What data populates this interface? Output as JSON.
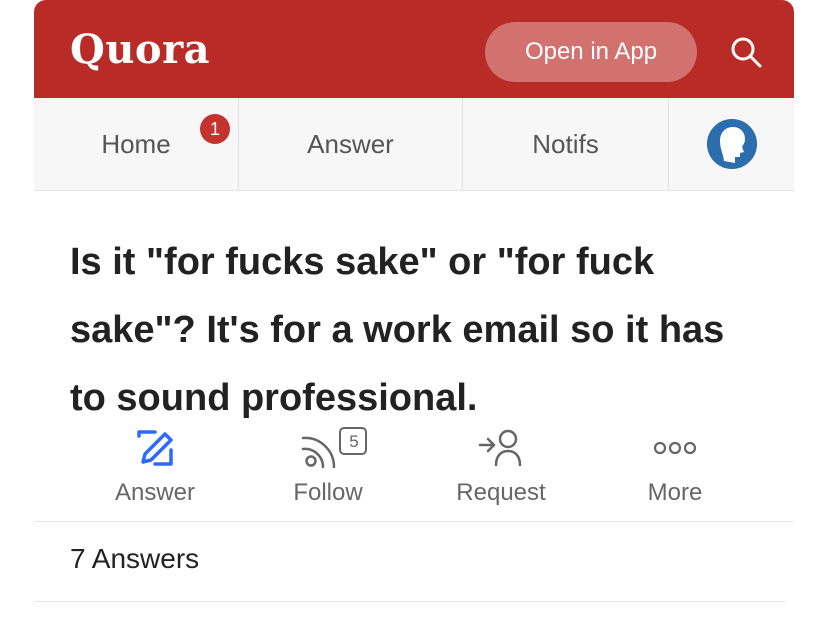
{
  "header": {
    "logo": "Quora",
    "open_in_app": "Open in App",
    "search_icon": "search-icon",
    "brand_color": "#b92b27"
  },
  "nav": {
    "home": "Home",
    "home_badge": "1",
    "answer": "Answer",
    "notifs": "Notifs",
    "profile_icon": "avatar"
  },
  "question": {
    "text": "Is it \"for fucks sake\" or \"for fuck sake\"? It's for a work email so it has to sound professional."
  },
  "actions": {
    "answer": "Answer",
    "follow": "Follow",
    "follow_count": "5",
    "request": "Request",
    "more": "More"
  },
  "answers_count": "7 Answers"
}
